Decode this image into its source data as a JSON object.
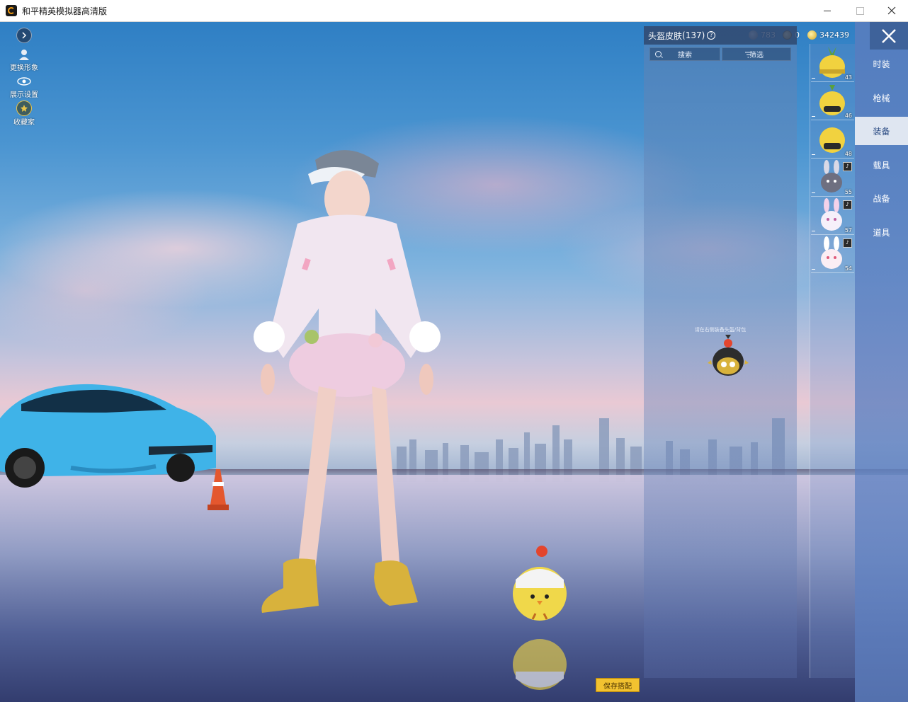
{
  "window": {
    "title": "和平精英模拟器高清版",
    "icons": {
      "app": "app-logo-icon",
      "minimize": "minimize-icon",
      "maximize": "maximize-icon",
      "close": "close-icon"
    }
  },
  "left_tools": {
    "expand_icon": "chevron-right-icon",
    "change_avatar_label": "更换形象",
    "display_settings_label": "展示设置",
    "favorites_label": "收藏家"
  },
  "currency": {
    "silver": "783",
    "medal": "0",
    "coupon": "342439"
  },
  "skin_panel": {
    "title": "头盔皮肤",
    "count": "(137)",
    "search_label": "搜索",
    "filter_label": "筛选",
    "hint": "请在右侧装备头盔/背包"
  },
  "items": [
    {
      "level": "43",
      "icon": "pineapple-helmet-icon"
    },
    {
      "level": "46",
      "icon": "yellow-helmet-icon"
    },
    {
      "level": "48",
      "icon": "yellow-helmet-icon"
    },
    {
      "level": "55",
      "icon": "bunny-backpack-icon"
    },
    {
      "level": "57",
      "icon": "bunny-backpack-icon"
    },
    {
      "level": "54",
      "icon": "bunny-backpack-icon"
    }
  ],
  "categories": [
    {
      "label": "时装",
      "active": false
    },
    {
      "label": "枪械",
      "active": false
    },
    {
      "label": "装备",
      "active": true
    },
    {
      "label": "载具",
      "active": false
    },
    {
      "label": "战备",
      "active": false
    },
    {
      "label": "道具",
      "active": false
    }
  ],
  "save_button": "保存搭配",
  "colors": {
    "accent_yellow": "#f2c230",
    "nav_blue": "#5a7dbe",
    "active_tab": "#dfe6f1"
  }
}
